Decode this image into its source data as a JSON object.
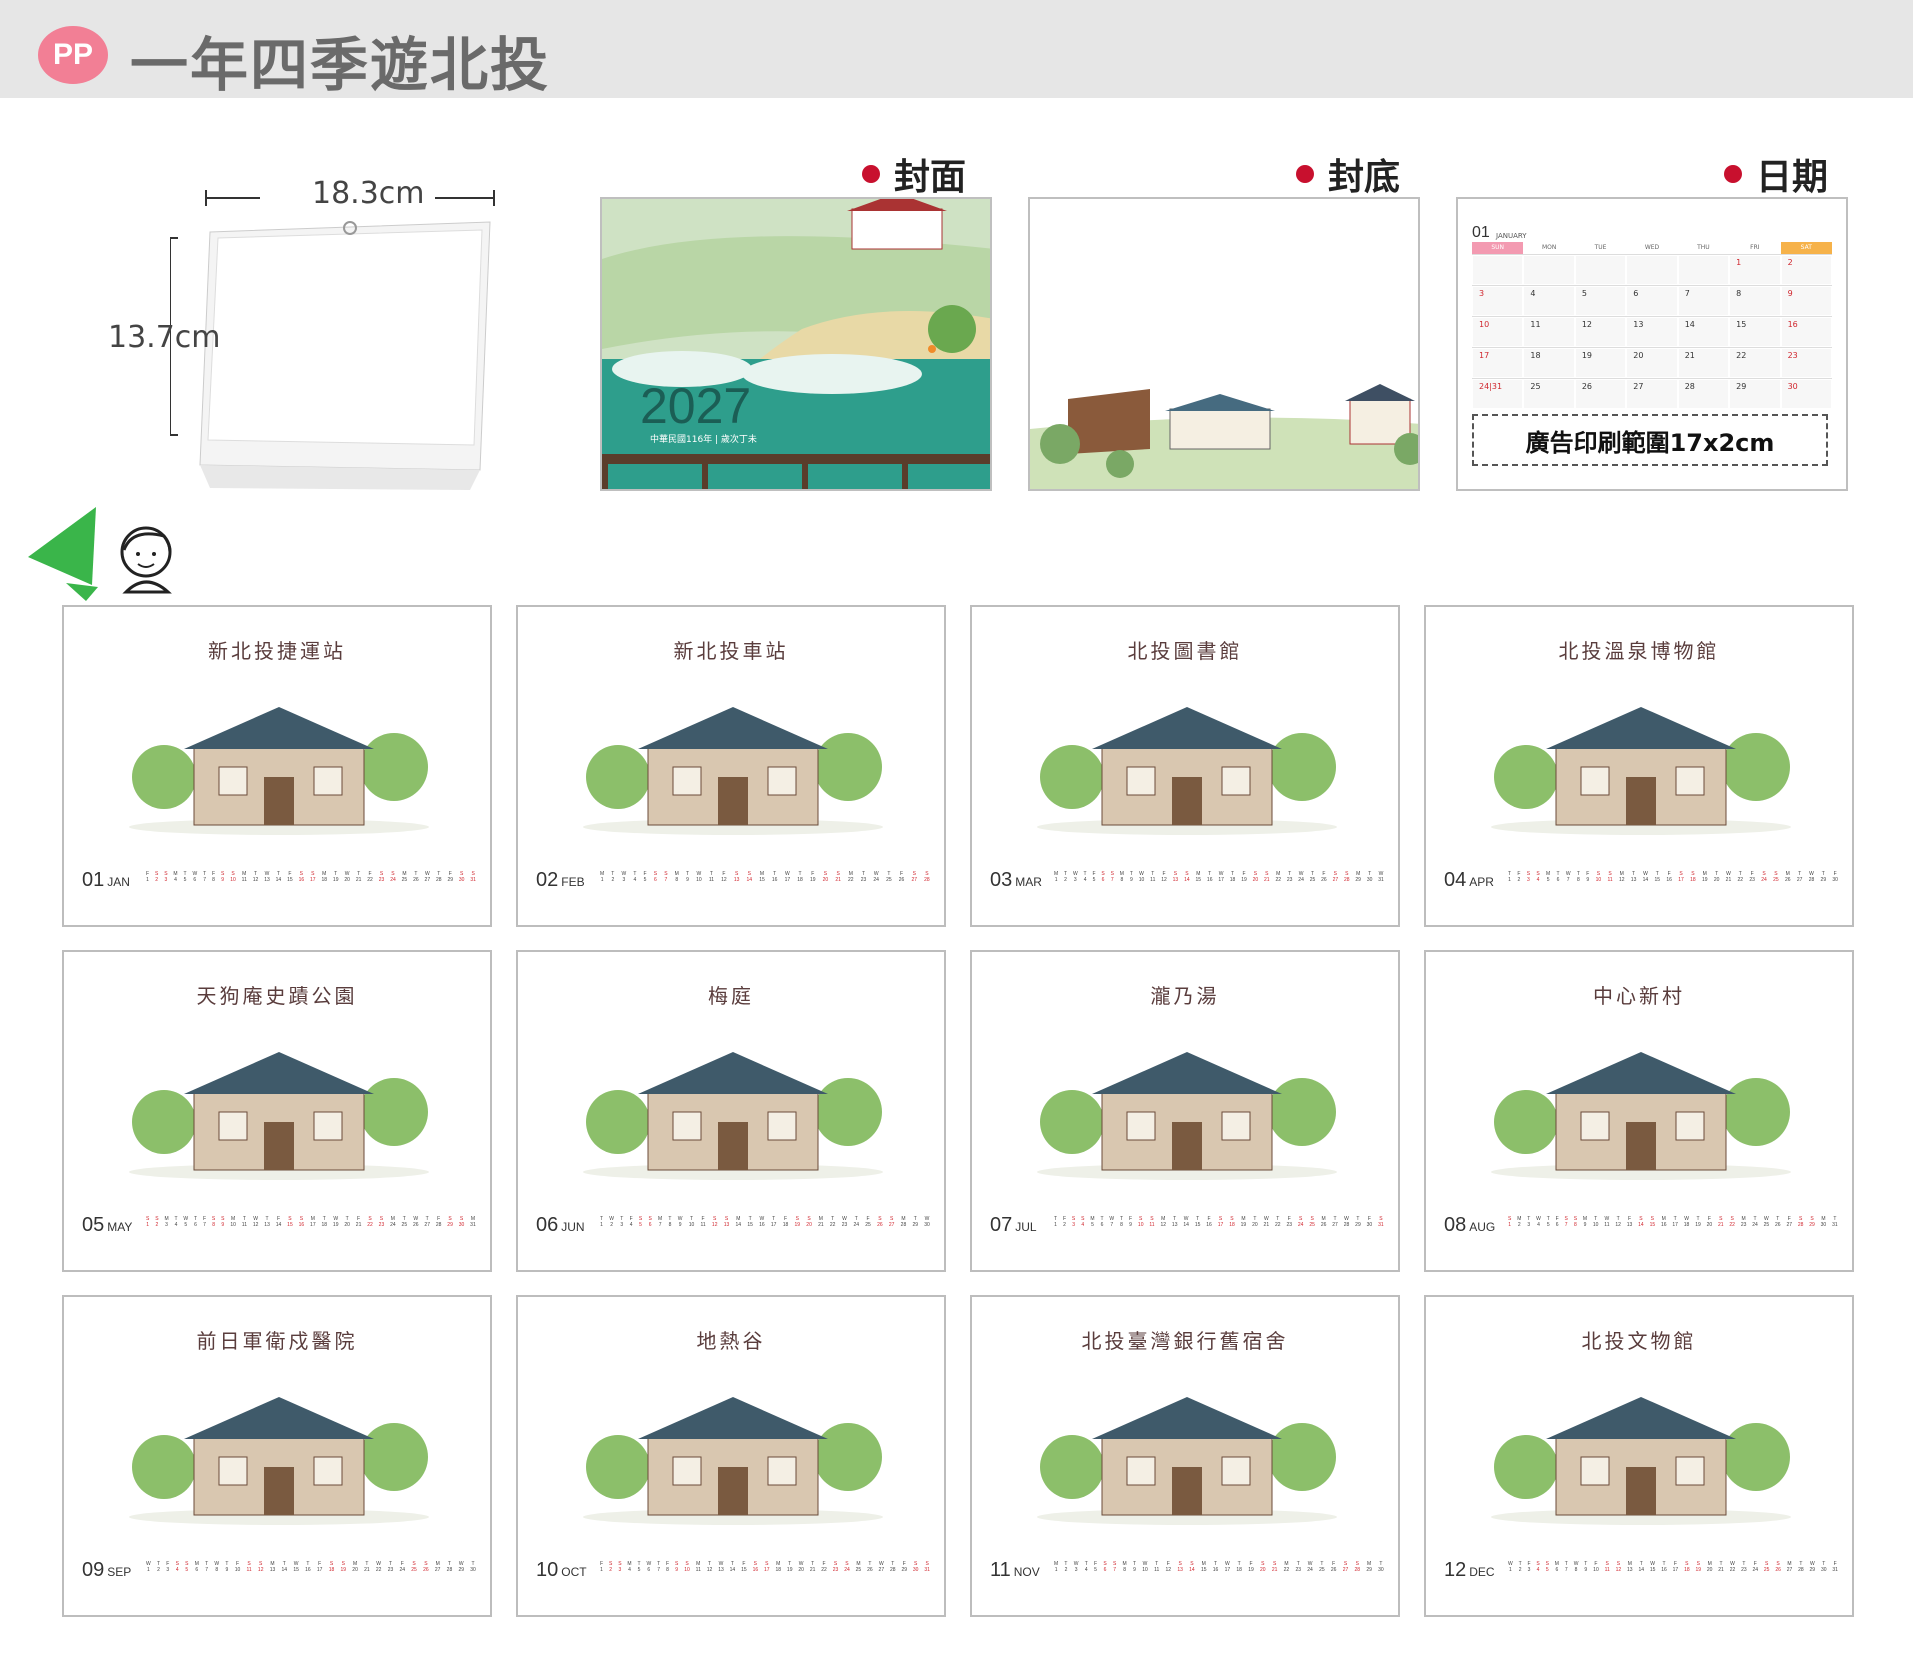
{
  "header": {
    "logo": "PP",
    "title": "一年四季遊北投"
  },
  "dimensions": {
    "width": "18.3cm",
    "height": "13.7cm"
  },
  "sections": {
    "cover": "封面",
    "back": "封底",
    "dates": "日期"
  },
  "cover": {
    "year": "2027",
    "subtitle": "中華民國116年 | 歲次丁未"
  },
  "date_sample": {
    "month": "01",
    "month_en": "JANUARY",
    "weekdays": [
      "SUN",
      "MON",
      "TUE",
      "WED",
      "THU",
      "FRI",
      "SAT"
    ],
    "ad_text": "廣告印刷範圍17x2cm"
  },
  "months": [
    {
      "num": "01",
      "abbr": "JAN",
      "title": "新北投捷運站"
    },
    {
      "num": "02",
      "abbr": "FEB",
      "title": "新北投車站"
    },
    {
      "num": "03",
      "abbr": "MAR",
      "title": "北投圖書館"
    },
    {
      "num": "04",
      "abbr": "APR",
      "title": "北投溫泉博物館"
    },
    {
      "num": "05",
      "abbr": "MAY",
      "title": "天狗庵史蹟公園"
    },
    {
      "num": "06",
      "abbr": "JUN",
      "title": "梅庭"
    },
    {
      "num": "07",
      "abbr": "JUL",
      "title": "瀧乃湯"
    },
    {
      "num": "08",
      "abbr": "AUG",
      "title": "中心新村"
    },
    {
      "num": "09",
      "abbr": "SEP",
      "title": "前日軍衛戍醫院"
    },
    {
      "num": "10",
      "abbr": "OCT",
      "title": "地熱谷"
    },
    {
      "num": "11",
      "abbr": "NOV",
      "title": "北投臺灣銀行舊宿舍"
    },
    {
      "num": "12",
      "abbr": "DEC",
      "title": "北投文物館"
    }
  ],
  "colors": {
    "accent": "#c8102e",
    "logo": "#f27f95",
    "green": "#3ab54a"
  }
}
